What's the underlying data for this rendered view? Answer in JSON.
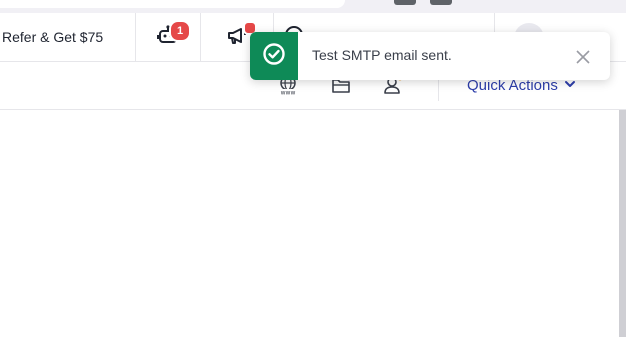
{
  "topbar": {
    "refer_label": "Refer & Get $75",
    "notifications_badge": "1",
    "icons": [
      "robot-icon",
      "megaphone-icon",
      "question-icon"
    ]
  },
  "subbar": {
    "icons": [
      "globe-www-icon",
      "folder-icon",
      "user-icon"
    ],
    "quick_actions_label": "Quick Actions"
  },
  "toast": {
    "message": "Test SMTP email sent.",
    "status": "success",
    "accent_color": "#0e8a57"
  },
  "colors": {
    "link_blue": "#2d3eaa",
    "badge_red": "#e54848"
  }
}
